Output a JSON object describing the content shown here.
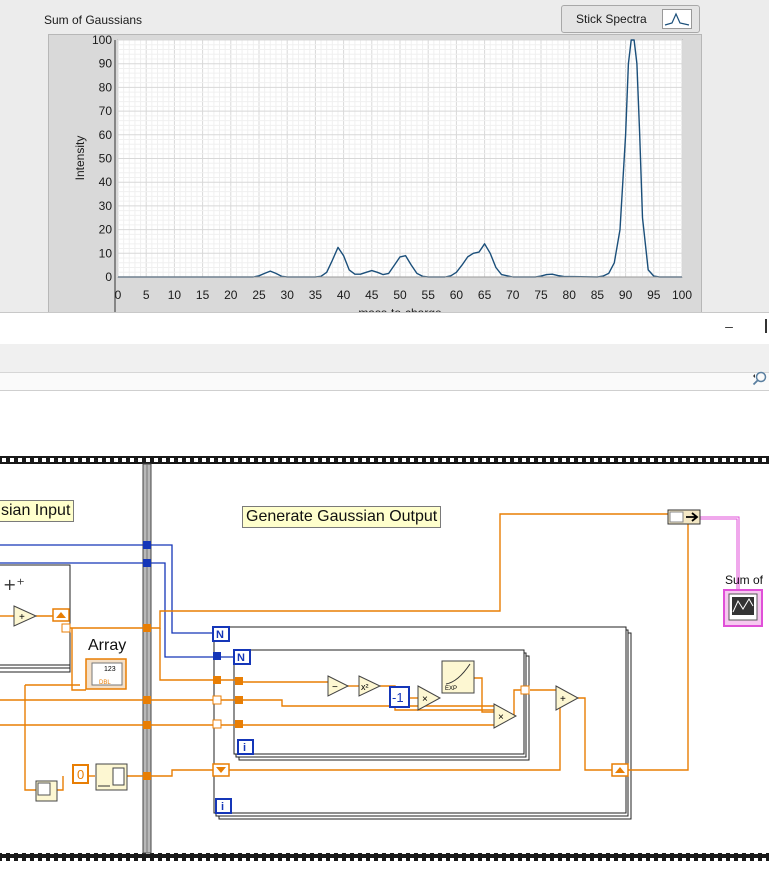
{
  "front_panel": {
    "graph_label": "Sum of Gaussians",
    "legend": {
      "label": "Stick Spectra",
      "icon": "line-plot-icon"
    }
  },
  "chart_data": {
    "type": "line",
    "title": "Sum of Gaussians",
    "xlabel": "mass-to-charge",
    "ylabel": "Intensity",
    "xlim": [
      0,
      100
    ],
    "ylim": [
      0,
      100
    ],
    "x_ticks": [
      0,
      5,
      10,
      15,
      20,
      25,
      30,
      35,
      40,
      45,
      50,
      55,
      60,
      65,
      70,
      75,
      80,
      85,
      90,
      95,
      100
    ],
    "y_ticks": [
      0,
      10,
      20,
      30,
      40,
      50,
      60,
      70,
      80,
      90,
      100
    ],
    "grid": true,
    "series": [
      {
        "name": "Stick Spectra",
        "color": "#1b4f7a",
        "x": [
          0,
          24,
          25,
          26,
          27,
          28,
          29,
          30,
          35,
          36,
          37,
          38,
          39,
          40,
          41,
          42,
          43,
          44,
          45,
          46,
          47,
          48,
          49,
          50,
          51,
          52,
          53,
          54,
          55,
          58,
          59,
          60,
          61,
          62,
          63,
          64,
          65,
          66,
          67,
          68,
          70,
          74,
          75,
          76,
          77,
          78,
          79,
          85,
          86,
          87,
          88,
          89,
          90,
          90.5,
          91,
          91.5,
          92,
          92.5,
          93,
          94,
          95,
          96,
          100
        ],
        "y": [
          0,
          0,
          0.5,
          1.5,
          2.5,
          1.5,
          0.3,
          0,
          0,
          0.3,
          2,
          7,
          12.5,
          9,
          3,
          1.2,
          1.2,
          2,
          2.7,
          2,
          1,
          1.5,
          5,
          8.5,
          9,
          5,
          1.5,
          0.3,
          0,
          0,
          0.5,
          2,
          5,
          8.5,
          10,
          10.5,
          14,
          10,
          4,
          1,
          0,
          0,
          0.4,
          1,
          1.2,
          0.6,
          0.2,
          0,
          0.4,
          1.5,
          6,
          20,
          60,
          90,
          100,
          100,
          90,
          60,
          25,
          3,
          0.4,
          0,
          0
        ]
      }
    ]
  },
  "block_diagram": {
    "labels": {
      "gaussian_input": "sian Input",
      "generate_output": "Generate Gaussian Output",
      "array": "Array",
      "sum_of": "Sum of"
    },
    "constants": {
      "zero": "0",
      "neg_one": "-1"
    },
    "terminals": {
      "count_N": "N",
      "iteration_i": "i",
      "array_num": "123",
      "array_type": "DBL"
    },
    "colors": {
      "orange_wire": "#e87e04",
      "blue_wire": "#1536b8",
      "pink_wire": "#e050d8",
      "label_bg": "#ffffcc"
    }
  },
  "window": {
    "minimize": "–"
  }
}
